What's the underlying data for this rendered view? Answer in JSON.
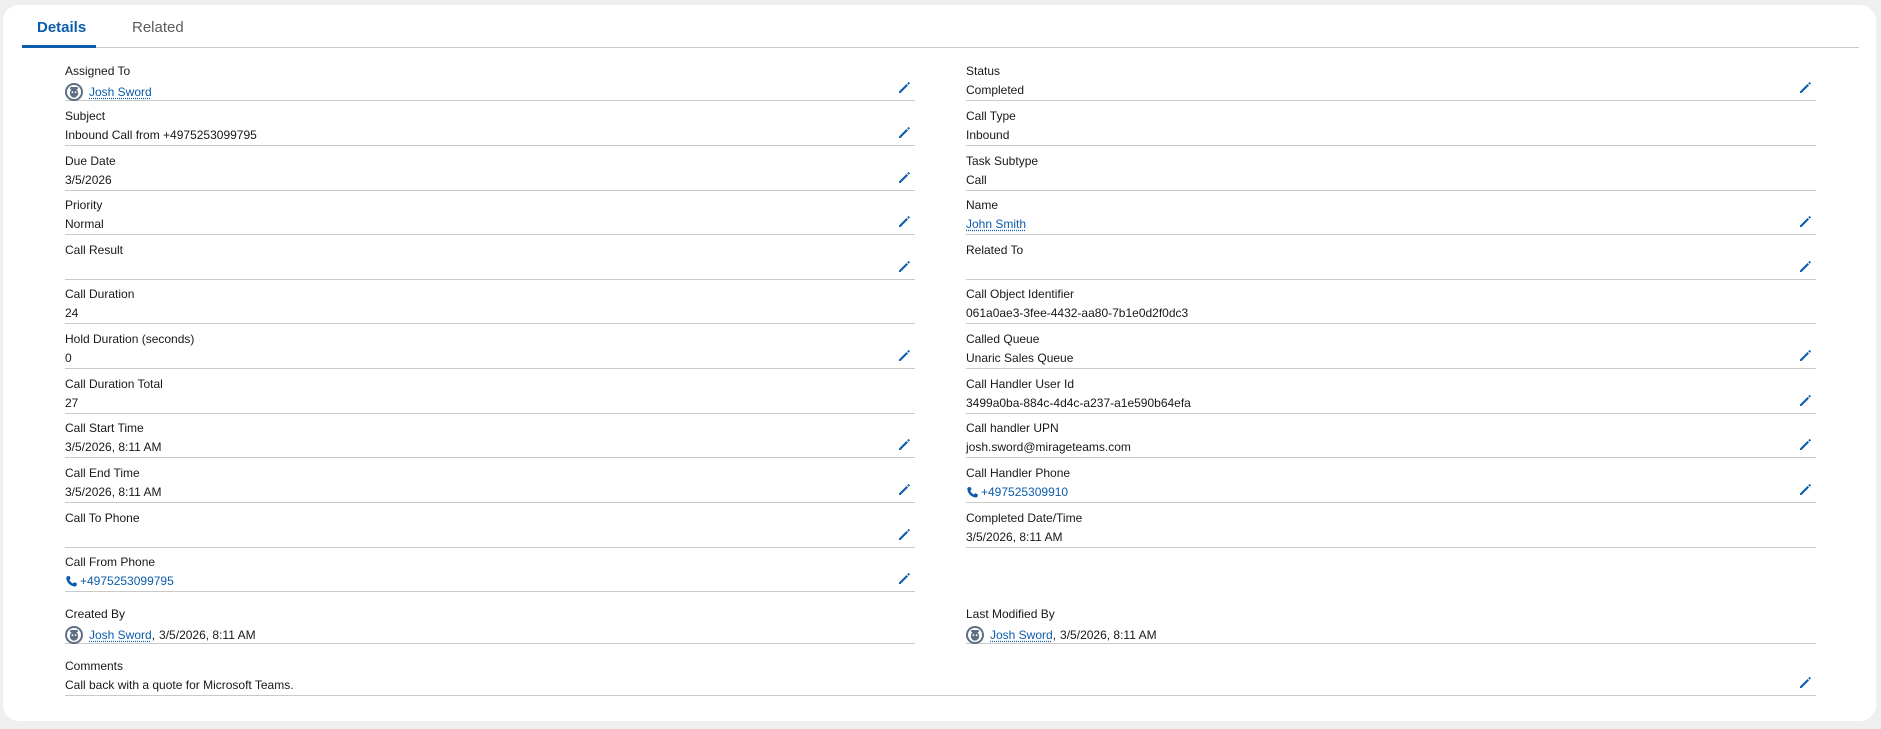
{
  "tabs": [
    {
      "label": "Details",
      "active": true
    },
    {
      "label": "Related",
      "active": false
    }
  ],
  "colors": {
    "accent": "#0b5cab",
    "divider": "#c9c9c9",
    "text": "#181818"
  },
  "left": {
    "assigned_to": {
      "label": "Assigned To",
      "value": "Josh Sword"
    },
    "subject": {
      "label": "Subject",
      "value": "Inbound Call from +4975253099795"
    },
    "due_date": {
      "label": "Due Date",
      "value": "3/5/2026"
    },
    "priority": {
      "label": "Priority",
      "value": "Normal"
    },
    "call_result": {
      "label": "Call Result",
      "value": ""
    },
    "call_duration": {
      "label": "Call Duration",
      "value": "24"
    },
    "hold_duration": {
      "label": "Hold Duration (seconds)",
      "value": "0"
    },
    "call_duration_total": {
      "label": "Call Duration Total",
      "value": "27"
    },
    "call_start_time": {
      "label": "Call Start Time",
      "value": "3/5/2026, 8:11 AM"
    },
    "call_end_time": {
      "label": "Call End Time",
      "value": "3/5/2026, 8:11 AM"
    },
    "call_to_phone": {
      "label": "Call To Phone",
      "value": ""
    },
    "call_from_phone": {
      "label": "Call From Phone",
      "value": "+4975253099795"
    },
    "created_by": {
      "label": "Created By",
      "user": "Josh Sword",
      "date": "3/5/2026, 8:11 AM"
    }
  },
  "right": {
    "status": {
      "label": "Status",
      "value": "Completed"
    },
    "call_type": {
      "label": "Call Type",
      "value": "Inbound"
    },
    "task_subtype": {
      "label": "Task Subtype",
      "value": "Call"
    },
    "name": {
      "label": "Name",
      "value": "John Smith"
    },
    "related_to": {
      "label": "Related To",
      "value": ""
    },
    "call_object_identifier": {
      "label": "Call Object Identifier",
      "value": "061a0ae3-3fee-4432-aa80-7b1e0d2f0dc3"
    },
    "called_queue": {
      "label": "Called Queue",
      "value": "Unaric Sales Queue"
    },
    "call_handler_user_id": {
      "label": "Call Handler User Id",
      "value": "3499a0ba-884c-4d4c-a237-a1e590b64efa"
    },
    "call_handler_upn": {
      "label": "Call handler UPN",
      "value": "josh.sword@mirageteams.com"
    },
    "call_handler_phone": {
      "label": "Call Handler Phone",
      "value": "+497525309910"
    },
    "completed_datetime": {
      "label": "Completed Date/Time",
      "value": "3/5/2026, 8:11 AM"
    },
    "last_modified_by": {
      "label": "Last Modified By",
      "user": "Josh Sword",
      "date": "3/5/2026, 8:11 AM"
    }
  },
  "comments": {
    "label": "Comments",
    "value": "Call back with a quote for Microsoft Teams."
  },
  "icons": {
    "edit": "pencil-icon",
    "avatar": "user-avatar-icon",
    "phone": "phone-icon"
  }
}
